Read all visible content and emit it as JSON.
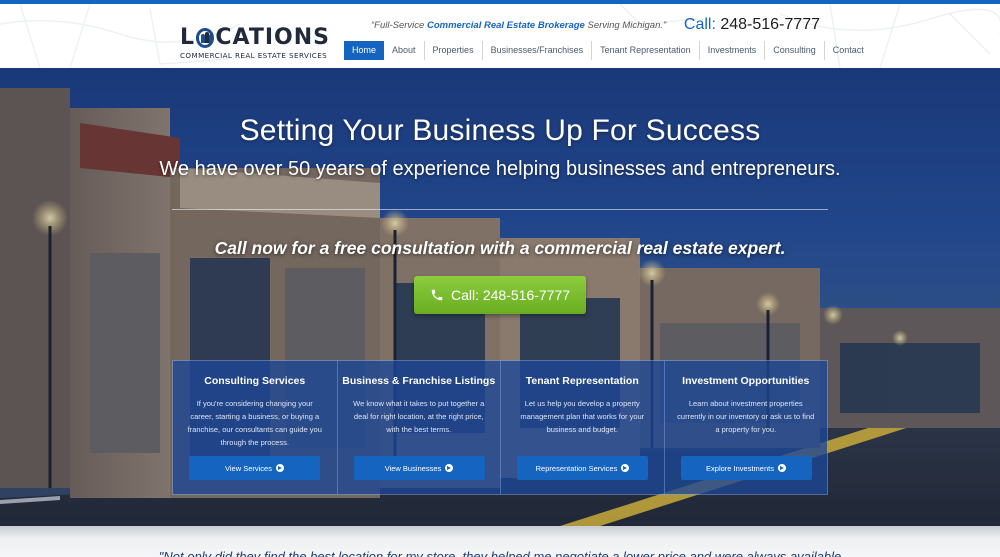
{
  "header": {
    "logo_text": "LOCATIONS",
    "logo_subtitle": "COMMERCIAL REAL ESTATE SERVICES",
    "tagline_prefix": "“Full-Service",
    "tagline_bold": "Commercial Real Estate Brokerage",
    "tagline_suffix": "Serving Michigan.”",
    "phone_label": "Call:",
    "phone_number": "248-516-7777"
  },
  "nav": {
    "items": [
      {
        "label": "Home"
      },
      {
        "label": "About"
      },
      {
        "label": "Properties"
      },
      {
        "label": "Businesses/Franchises"
      },
      {
        "label": "Tenant Representation"
      },
      {
        "label": "Investments"
      },
      {
        "label": "Consulting"
      },
      {
        "label": "Contact"
      }
    ]
  },
  "hero": {
    "title": "Setting Your Business Up For Success",
    "subtitle": "We have over 50 years of experience helping businesses and entrepreneurs.",
    "cta_text": "Call now for a free consultation with a commercial real estate expert.",
    "cta_button": "Call: 248-516-7777"
  },
  "services": [
    {
      "title": "Consulting Services",
      "description": "If you're considering changing your career, starting a business, or buying a franchise, our consultants can guide you through the process.",
      "button": "View Services"
    },
    {
      "title": "Business & Franchise Listings",
      "description": "We know what it takes to put together a deal for right location, at the right price, with the best terms.",
      "button": "View Businesses"
    },
    {
      "title": "Tenant Representation",
      "description": "Let us help you develop a property management plan that works for your business and budget.",
      "button": "Representation Services"
    },
    {
      "title": "Investment Opportunities",
      "description": "Learn about investment properties currently in our inventory or ask us to find a property for you.",
      "button": "Explore Investments"
    }
  ],
  "testimonial": {
    "text": "\"Not only did they find the best location for my store, they helped me negotiate a lower price and were always available"
  },
  "colors": {
    "brand_blue": "#1565c0",
    "cta_green": "#7bbf2f",
    "logo_dark": "#202a3a"
  }
}
